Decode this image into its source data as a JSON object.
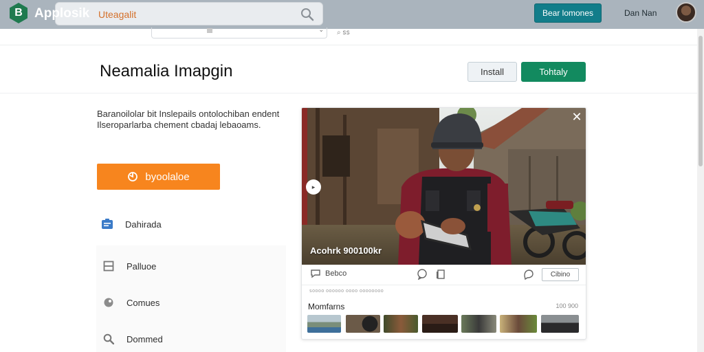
{
  "app": {
    "logo_letter": "B",
    "name": "Applosik",
    "search_text": "Uteagalit",
    "cta_label": "Bear lomones",
    "user_name": "Dan Nan"
  },
  "subbar": {
    "search_hint": "⌕ ꜱꜱ"
  },
  "header": {
    "title": "Neamalia Imapgin",
    "install_label": "Install",
    "primary_label": "Tohtaly"
  },
  "left": {
    "description": "Baranoilolar bit Inslepails ontolochiban endent Ilseroparlarba chement cbadaj lebaoams.",
    "orange_button_label": "byoolaloe",
    "nav_items": [
      {
        "label": "Dahirada",
        "icon": "id-card-icon",
        "icon_color": "#3b7bc8"
      },
      {
        "label": "Palluoe",
        "icon": "square-icon",
        "icon_color": "#777777"
      },
      {
        "label": "Comues",
        "icon": "circle-icon",
        "icon_color": "#888888"
      },
      {
        "label": "Dommed",
        "icon": "search-icon",
        "icon_color": "#777777"
      }
    ]
  },
  "media": {
    "caption": "Acohrk 900100kr",
    "actions": [
      {
        "label": "Bebco",
        "icon": "comment-icon"
      },
      {
        "label": "",
        "icon": "bubble-icon"
      },
      {
        "label": "",
        "icon": "copy-icon"
      },
      {
        "label": "",
        "icon": "tag-icon"
      }
    ],
    "action_button_label": "Cibino",
    "meta": "ꜱᴏᴏᴏᴏ ᴏᴏᴏᴏᴏᴏ ᴏᴏᴏᴏ ᴏᴏᴏᴏᴏᴏᴏᴏ",
    "related_title": "Momfarns",
    "related_count": "100 900",
    "thumbnail_count": 7
  },
  "colors": {
    "topbar": "#aab4bd",
    "teal": "#127d8a",
    "green": "#128a5f",
    "orange": "#f7851e"
  }
}
